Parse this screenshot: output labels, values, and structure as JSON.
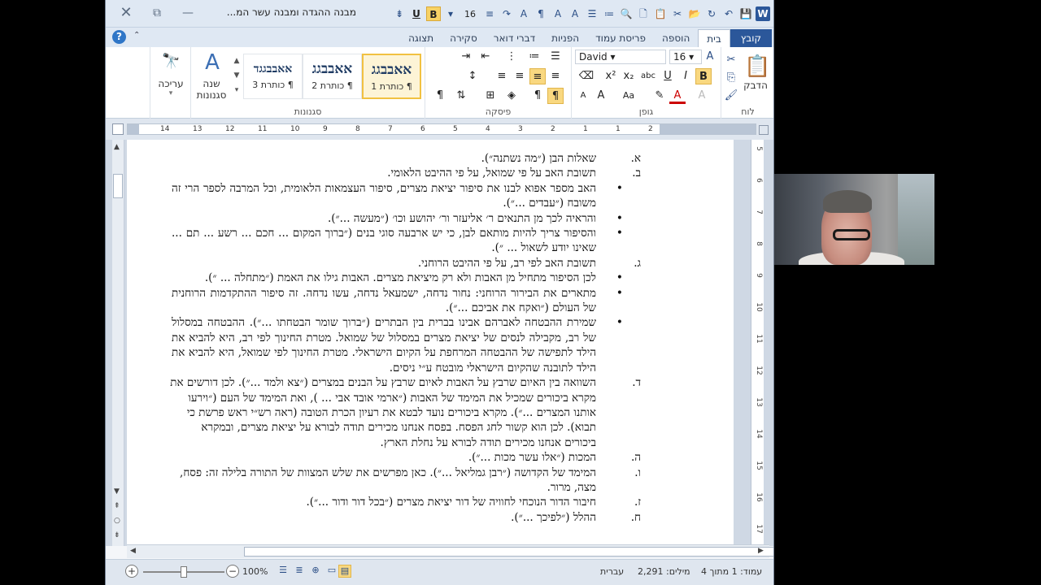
{
  "window": {
    "title": "מבנה ההגדה ומבנה עשר המ...",
    "qat_font_size": "16"
  },
  "tabs": [
    {
      "label": "קובץ",
      "type": "file"
    },
    {
      "label": "בית",
      "type": "active"
    },
    {
      "label": "הוספה"
    },
    {
      "label": "פריסת עמוד"
    },
    {
      "label": "הפניות"
    },
    {
      "label": "דברי דואר"
    },
    {
      "label": "סקירה"
    },
    {
      "label": "תצוגה"
    }
  ],
  "ribbon": {
    "clipboard": {
      "label": "לוח",
      "paste": "הדבק"
    },
    "font": {
      "label": "גופן",
      "name": "David",
      "size": "16"
    },
    "paragraph": {
      "label": "פיסקה"
    },
    "styles": {
      "label": "סגנונות",
      "cards": [
        {
          "preview": "אאבבגג",
          "name": "¶ כותרת 1"
        },
        {
          "preview": "אאבבגג",
          "name": "¶ כותרת 2"
        },
        {
          "preview": "אאבבגגד",
          "name": "¶ כותרת 3"
        }
      ],
      "change": "שנה סגנונות"
    },
    "editing": {
      "label": "עריכה"
    }
  },
  "ruler": {
    "numbers": [
      "14",
      "13",
      "12",
      "11",
      "10",
      "9",
      "8",
      "7",
      "6",
      "5",
      "4",
      "3",
      "2",
      "1",
      "1",
      "2"
    ],
    "vnumbers": [
      "5",
      "6",
      "7",
      "8",
      "9",
      "10",
      "11",
      "12",
      "13",
      "14",
      "15",
      "16",
      "17"
    ]
  },
  "document": {
    "items": [
      {
        "marker": "א.",
        "text": "שאלות הבן (״מה נשתנה״)."
      },
      {
        "marker": "ב.",
        "text": "תשובת האב על פי שמואל, על פי ההיבט הלאומי."
      },
      {
        "bullet": true,
        "text": "האב מספר אפוא לבנו את סיפור יציאת מצרים, סיפור העצמאות הלאומית, וכל המרבה לספר הרי זה משובח (״עבדים ...״)."
      },
      {
        "bullet": true,
        "text": "והראיה לכך מן התנאים ר׳ אליעזר ור׳ יהושע וכו׳ (״מעשה ...״)."
      },
      {
        "bullet": true,
        "text": "והסיפור צריך להיות מותאם לבן, כי יש ארבעה סוגי בנים (״ברוך המקום ... חכם ... רשע ... תם ... שאינו יודע לשאול ... ״)."
      },
      {
        "marker": "ג.",
        "text": "תשובת האב לפי רב, על פי ההיבט הרוחני."
      },
      {
        "bullet": true,
        "text": "לכן הסיפור מתחיל מן האבות ולא רק מיציאת מצרים. האבות גילו את האמת (״מתחלה ... ״)."
      },
      {
        "bullet": true,
        "text": "מתארים את הבירור הרוחני: נחור נדחה, ישמעאל נדחה, עשו נדחה. זה סיפור ההתקדמות הרוחנית של העולם (״ואקח את אביכם ...״)."
      },
      {
        "bullet": true,
        "text": "שמירת ההבטחה לאברהם אבינו בברית בין הבתרים (״ברוך שומר הבטחתו ...״). ההבטחה במסלול של רב, מקבילה לנסים של יציאת מצרים במסלול של שמואל. מטרת החינוך לפי רב, היא להביא את הילד לתפישה של ההבטחה המרחפת על הקיום הישראלי. מטרת החינוך לפי שמואל, היא להביא את הילד לתובנה שהקיום הישראלי מובטח ע״י ניסים."
      },
      {
        "marker": "ד.",
        "text": "השוואה בין האיום שרבץ על האבות לאיום שרבץ על הבנים במצרים (״צא ולמד ...״). לכן דורשים את מקרא ביכורים שמכיל את המימד של האבות (״ארמי אובד אבי ... ), ואת המימד של העם (״וירעו אותנו המצרים ...״). מקרא ביכורים נועד לבטא את רעיון הכרת הטובה (ראה רש״י ראש פרשת כי תבוא). לכן הוא קשור לחג הפסח. בפסח אנחנו מכירים תודה לבורא על יציאת מצרים, ובמקרא ביכורים אנחנו מכירים תודה לבורא על נחלת הארץ."
      },
      {
        "marker": "ה.",
        "text": "המכות (״אלו עשר מכות ...״)."
      },
      {
        "marker": "ו.",
        "text": "המימד של הקדושה (״רבן גמליאל ...״). כאן מפרשים את שלש המצוות של התורה בלילה זה: פסח, מצה, מרור."
      },
      {
        "marker": "ז.",
        "text": "חיבור הדור הנוכחי לחוויה של דור יציאת מצרים (״בכל דור ודור ...״)."
      },
      {
        "marker": "ח.",
        "text": "ההלל (״לפיכך ...״)."
      }
    ]
  },
  "status": {
    "page": "עמוד: 1 מתוך 4",
    "words": "מילים: 2,291",
    "language": "עברית",
    "zoom": "100%",
    "zoom_fraction": 0.5
  }
}
